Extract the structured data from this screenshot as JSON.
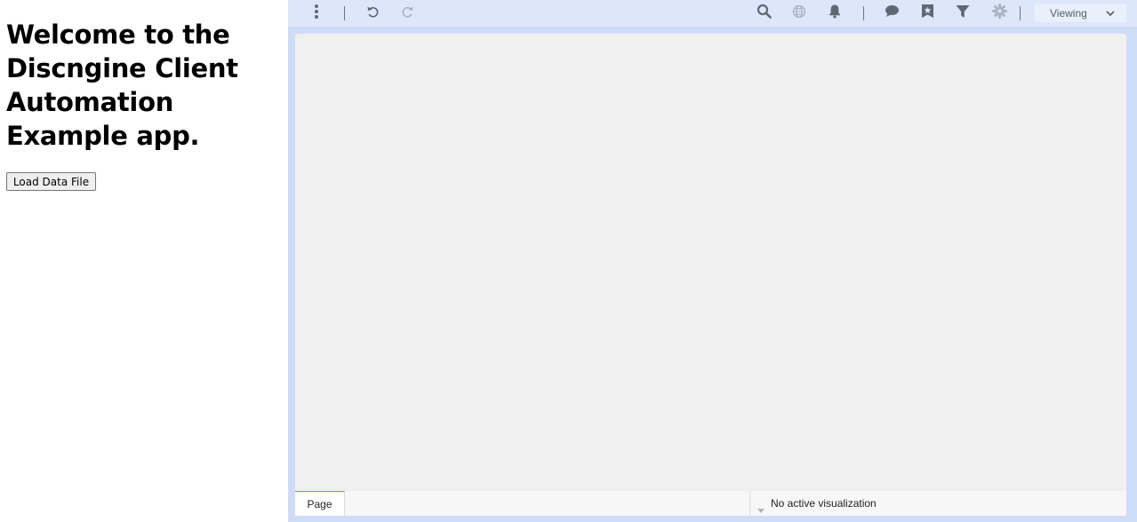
{
  "left_panel": {
    "heading": "Welcome to the Discngine Client Automation Example app.",
    "load_button_label": "Load Data File"
  },
  "toolbar": {
    "icons": [
      "more-vertical-icon",
      "undo-icon",
      "redo-icon",
      "search-icon",
      "globe-icon",
      "bell-icon",
      "comment-icon",
      "bookmark-star-icon",
      "filter-icon",
      "gear-icon",
      "chevron-down-icon"
    ],
    "viewing_label": "Viewing",
    "colors": {
      "active_icon": "#5f6773",
      "disabled_icon": "#aab3c2",
      "toolbar_bg": "#dde7fb",
      "frame_bg": "#cfdcf8"
    }
  },
  "status_bar": {
    "page_tab_label": "Page",
    "visualization_status": "No active visualization"
  }
}
